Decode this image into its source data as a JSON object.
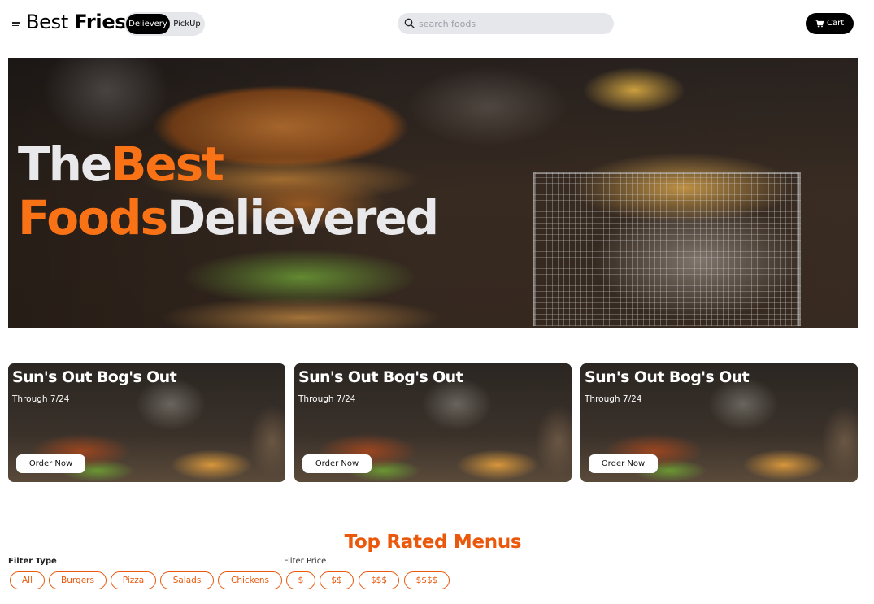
{
  "header": {
    "brand_light": "Best",
    "brand_bold": "Fries",
    "toggle": {
      "active": "Delievery",
      "inactive": "PickUp"
    },
    "search": {
      "placeholder": "search foods",
      "value": ""
    },
    "cart_label": "Cart"
  },
  "hero": {
    "line1_white": "The",
    "line1_orange": "Best",
    "line2_orange": "Foods",
    "line2_white": "Delievered"
  },
  "promos": [
    {
      "title": "Sun's Out Bog's Out",
      "subtitle": "Through 7/24",
      "button": "Order Now"
    },
    {
      "title": "Sun's Out Bog's Out",
      "subtitle": "Through 7/24",
      "button": "Order Now"
    },
    {
      "title": "Sun's Out Bog's Out",
      "subtitle": "Through 7/24",
      "button": "Order Now"
    }
  ],
  "menus": {
    "title": "Top Rated Menus",
    "filter_type_label": "Filter Type",
    "filter_price_label": "Filter Price",
    "type_chips": [
      "All",
      "Burgers",
      "Pizza",
      "Salads",
      "Chickens"
    ],
    "price_chips": [
      "$",
      "$$",
      "$$$",
      "$$$$"
    ]
  },
  "colors": {
    "accent": "#ea580c",
    "hero_accent": "#f97316",
    "dark": "#000000",
    "chip_bg": "#e5e7eb"
  }
}
